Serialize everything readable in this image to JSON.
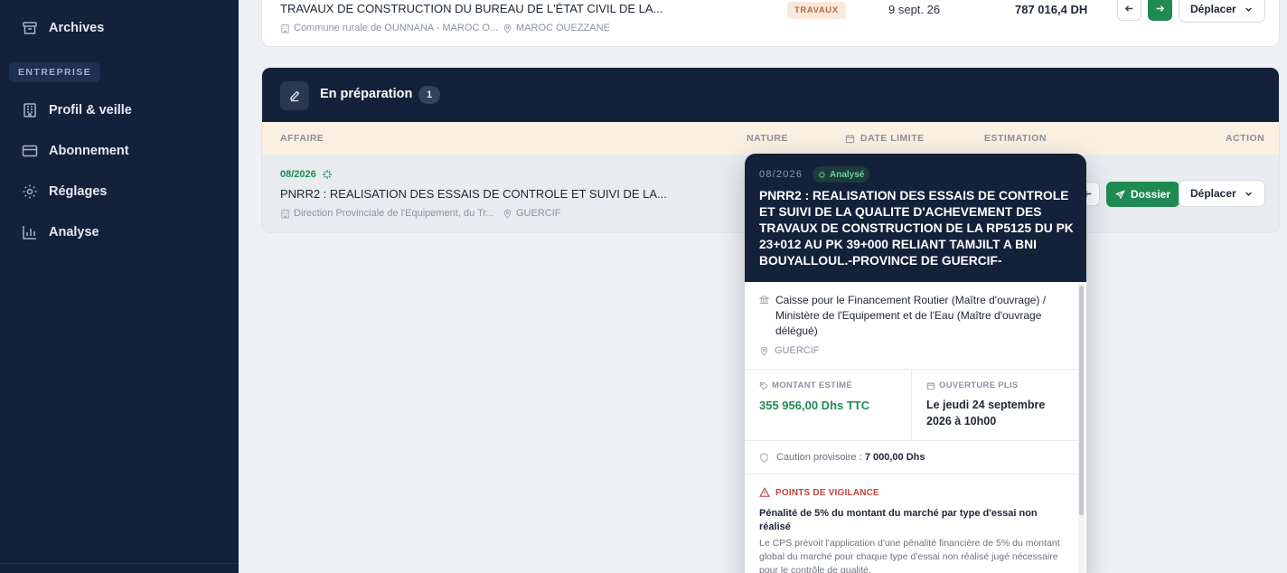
{
  "sidebar": {
    "items_top": [
      {
        "label": "Archives",
        "icon": "archive-icon"
      }
    ],
    "section": "ENTREPRISE",
    "items": [
      {
        "label": "Profil & veille",
        "icon": "building-icon"
      },
      {
        "label": "Abonnement",
        "icon": "card-icon"
      },
      {
        "label": "Réglages",
        "icon": "gear-icon"
      },
      {
        "label": "Analyse",
        "icon": "chart-icon"
      }
    ]
  },
  "top_row": {
    "title": "TRAVAUX DE CONSTRUCTION DU BUREAU DE L'ÉTAT CIVIL DE LA...",
    "buyer": "Commune rurale de OUNNANA - MAROC O...",
    "location": "MAROC OUEZZANE",
    "nature": "TRAVAUX",
    "date": "9 sept. 26",
    "amount": "787 016,4 DH",
    "move_label": "Déplacer"
  },
  "prep": {
    "title": "En préparation",
    "count": "1",
    "columns": {
      "affaire": "AFFAIRE",
      "nature": "NATURE",
      "date": "DATE LIMITE",
      "estimation": "ESTIMATION",
      "action": "ACTION"
    },
    "row": {
      "ref": "08/2026",
      "title": "PNRR2 : REALISATION DES ESSAIS DE CONTROLE ET SUIVI DE LA...",
      "buyer": "Direction Provinciale de l'Equipement, du Tr...",
      "location": "GUERCIF",
      "dossier_label": "Dossier",
      "move_label": "Déplacer"
    }
  },
  "popover": {
    "ref": "08/2026",
    "status": "Analysé",
    "title": "PNRR2 : REALISATION DES ESSAIS DE CONTROLE ET SUIVI DE LA QUALITE D'ACHEVEMENT DES TRAVAUX DE CONSTRUCTION DE LA RP5125 DU PK 23+012 AU PK 39+000 RELIANT TAMJILT A BNI BOUYALLOUL.-PROVINCE DE GUERCIF-",
    "organization": "Caisse pour le Financement Routier (Maître d'ouvrage) / Ministère de l'Equipement et de l'Eau (Maître d'ouvrage délégué)",
    "location": "GUERCIF",
    "montant_label": "MONTANT ESTIMÉ",
    "montant_value": "355 956,00 Dhs TTC",
    "ouverture_label": "OUVERTURE PLIS",
    "ouverture_value": "Le jeudi 24 septembre 2026 à 10h00",
    "caution_label": "Caution provisoire :",
    "caution_value": "7 000,00 Dhs",
    "vigilance_label": "POINTS DE VIGILANCE",
    "vigilance_title": "Pénalité de 5% du montant du marché par type d'essai non réalisé",
    "vigilance_text": "Le CPS prévoit l'application d'une pénalité financière de 5% du montant global du marché pour chaque type d'essai non réalisé jugé nécessaire pour le contrôle de qualité."
  },
  "colors": {
    "sidebar": "#14213a",
    "accent": "#1f8a53",
    "warning": "#c2413a",
    "badge": "#fbe8dc"
  }
}
